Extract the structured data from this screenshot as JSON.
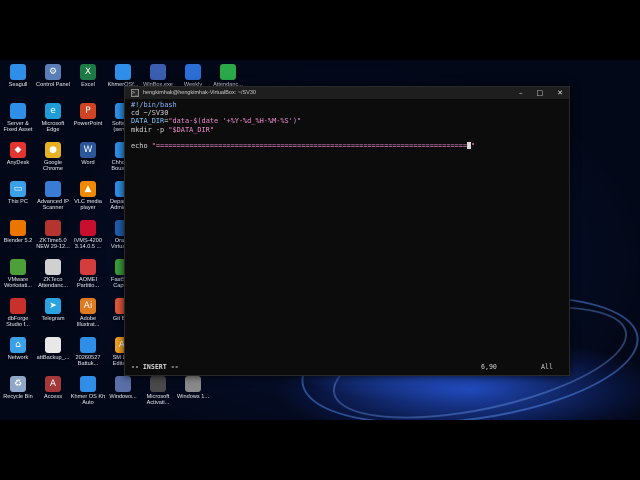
{
  "desktop_icons": [
    {
      "label": "Seagull",
      "icon": "seagull-folder-icon",
      "color": "#2f8fe8"
    },
    {
      "label": "Control Panel",
      "icon": "control-panel-icon",
      "color": "#5a7fb8"
    },
    {
      "label": "Excel",
      "icon": "excel-icon",
      "color": "#1d7a45"
    },
    {
      "label": "KhmerOSf...",
      "icon": "folder-icon",
      "color": "#2f8fe8"
    },
    {
      "label": "WinBox.exe",
      "icon": "winbox-icon",
      "color": "#3a5fae"
    },
    {
      "label": "Weekly",
      "icon": "weekly-doc-icon",
      "color": "#2b6fd6"
    },
    {
      "label": "Attendanc...",
      "icon": "attendance-icon",
      "color": "#2aa84a"
    },
    {
      "label": "Server & Fixed Asset",
      "icon": "server-folder-icon",
      "color": "#2f8fe8"
    },
    {
      "label": "Microsoft Edge",
      "icon": "edge-icon",
      "color": "#1f9bd8"
    },
    {
      "label": "PowerPoint",
      "icon": "powerpoint-icon",
      "color": "#d04423"
    },
    {
      "label": "Software (server)",
      "icon": "software-folder-icon",
      "color": "#2f8fe8"
    },
    {
      "label": "AnyDesk",
      "icon": "anydesk-icon",
      "color": "#e3342f"
    },
    {
      "label": "Google Chrome",
      "icon": "chrome-icon",
      "color": "#e8b123"
    },
    {
      "label": "Word",
      "icon": "word-icon",
      "color": "#2b579a"
    },
    {
      "label": "Chhoer... Boustry...",
      "icon": "folder-icon",
      "color": "#2f8fe8"
    },
    {
      "label": "This PC",
      "icon": "this-pc-icon",
      "color": "#3aa0e8"
    },
    {
      "label": "Advanced IP Scanner",
      "icon": "ip-scanner-icon",
      "color": "#3a7bd5"
    },
    {
      "label": "VLC media player",
      "icon": "vlc-icon",
      "color": "#f08a00"
    },
    {
      "label": "Departm... Admin 2...",
      "icon": "folder-icon",
      "color": "#2f8fe8"
    },
    {
      "label": "Blender 5.2",
      "icon": "blender-icon",
      "color": "#ea7600"
    },
    {
      "label": "ZKTime5.0 NEW 29-12...",
      "icon": "zktime-icon",
      "color": "#b5342f"
    },
    {
      "label": "IVMS-4200 3.14.0.5 ...",
      "icon": "ivms-icon",
      "color": "#c8102e"
    },
    {
      "label": "Oracle VirtualB...",
      "icon": "virtualbox-icon",
      "color": "#1f5fae"
    },
    {
      "label": "VMware Workstati...",
      "icon": "vmware-icon",
      "color": "#4d9f3a"
    },
    {
      "label": "ZKTeco Attendanc...",
      "icon": "zkteco-icon",
      "color": "#d0d0d0"
    },
    {
      "label": "AOMEI Partitio...",
      "icon": "aomei-icon",
      "color": "#d33d3d"
    },
    {
      "label": "FastSto... Captu...",
      "icon": "faststone-icon",
      "color": "#3b9d3b"
    },
    {
      "label": "dbForge Studio f...",
      "icon": "dbforge-icon",
      "color": "#c9302c"
    },
    {
      "label": "Telegram",
      "icon": "telegram-icon",
      "color": "#2aa3e0"
    },
    {
      "label": "Adobe Illustrat...",
      "icon": "illustrator-icon",
      "color": "#e07a1f"
    },
    {
      "label": "Git Ba...",
      "icon": "git-bash-icon",
      "color": "#e0583a"
    },
    {
      "label": "Network",
      "icon": "network-icon",
      "color": "#3aa0e8"
    },
    {
      "label": "attBackup_...",
      "icon": "backup-file-icon",
      "color": "#e8e8e8"
    },
    {
      "label": "20260527 Battuk...",
      "icon": "folder-icon",
      "color": "#2f8fe8"
    },
    {
      "label": "SM Lo... Editab...",
      "icon": "ai-file-icon",
      "color": "#f0a020"
    },
    {
      "label": "Recycle Bin",
      "icon": "recycle-bin-icon",
      "color": "#8fa8c8"
    },
    {
      "label": "Access",
      "icon": "access-icon",
      "color": "#a4373a"
    },
    {
      "label": "Khmer OS Kh Auto",
      "icon": "folder-icon",
      "color": "#2f8fe8"
    },
    {
      "label": "Windows...",
      "icon": "windows-tool-icon",
      "color": "#5a6ea8"
    },
    {
      "label": "Microsoft Activati...",
      "icon": "activation-icon",
      "color": "#4a4a4a"
    },
    {
      "label": "Windows 1...",
      "icon": "windows-image-icon",
      "color": "#8a8a8a"
    }
  ],
  "terminal": {
    "title": "hengkimhak@hengkimhak-VirtualBox: ~/SV30",
    "icon_glyph": ">_",
    "controls": {
      "minimize": "–",
      "maximize": "□",
      "close": "✕"
    },
    "lines": [
      {
        "parts": [
          {
            "cls": "c-comment",
            "text": "#!/bin/bash"
          }
        ]
      },
      {
        "parts": [
          {
            "cls": "c-cmd",
            "text": "cd ~/SV30"
          }
        ]
      },
      {
        "parts": [
          {
            "cls": "c-var",
            "text": "DATA_DIR"
          },
          {
            "cls": "c-eq",
            "text": "="
          },
          {
            "cls": "c-str",
            "text": "\"data-$(date '+%Y-%d_%H-%M-%S')\""
          }
        ]
      },
      {
        "parts": [
          {
            "cls": "c-cmd",
            "text": "mkdir -p "
          },
          {
            "cls": "c-str",
            "text": "\"$DATA_DIR\""
          }
        ]
      },
      {
        "parts": [
          {
            "cls": "c-cmd",
            "text": ""
          }
        ]
      },
      {
        "parts": [
          {
            "cls": "c-cmd",
            "text": "echo "
          },
          {
            "cls": "c-str",
            "text": "\"==========================================================================="
          },
          {
            "cls": "cursor",
            "text": ""
          },
          {
            "cls": "c-str",
            "text": "\""
          }
        ]
      }
    ],
    "status": {
      "mode": "-- INSERT --",
      "position": "6,90",
      "scroll": "All"
    }
  }
}
